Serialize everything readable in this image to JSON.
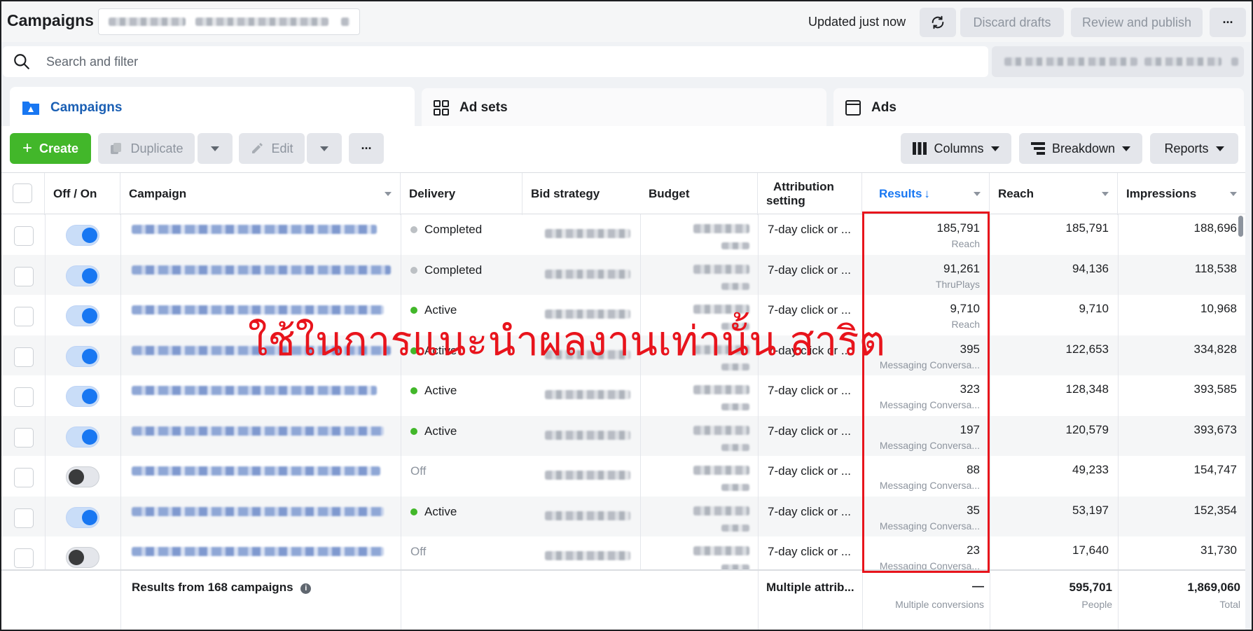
{
  "app": {
    "title": "Campaigns",
    "updated": "Updated just now",
    "discard_label": "Discard drafts",
    "review_label": "Review and publish",
    "more_label": "···"
  },
  "search": {
    "placeholder": "Search and filter"
  },
  "tabs": [
    {
      "label": "Campaigns",
      "icon": "folder-icon",
      "active": true
    },
    {
      "label": "Ad sets",
      "icon": "grid-icon",
      "active": false
    },
    {
      "label": "Ads",
      "icon": "ad-frame-icon",
      "active": false
    }
  ],
  "toolbar": {
    "create_label": "Create",
    "duplicate_label": "Duplicate",
    "edit_label": "Edit",
    "columns_label": "Columns",
    "breakdown_label": "Breakdown",
    "reports_label": "Reports"
  },
  "columns": {
    "offon": "Off / On",
    "campaign": "Campaign",
    "delivery": "Delivery",
    "bid_strategy": "Bid strategy",
    "budget": "Budget",
    "attribution_line1": "Attribution",
    "attribution_line2": "setting",
    "results": "Results",
    "reach": "Reach",
    "impressions": "Impressions"
  },
  "rows": [
    {
      "on": true,
      "delivery": "Completed",
      "status": "completed",
      "attribution": "7-day click or ...",
      "results": "185,791",
      "result_type": "Reach",
      "reach": "185,791",
      "impressions": "188,696"
    },
    {
      "on": true,
      "delivery": "Completed",
      "status": "completed",
      "attribution": "7-day click or ...",
      "results": "91,261",
      "result_type": "ThruPlays",
      "reach": "94,136",
      "impressions": "118,538"
    },
    {
      "on": true,
      "delivery": "Active",
      "status": "active",
      "attribution": "7-day click or ...",
      "results": "9,710",
      "result_type": "Reach",
      "reach": "9,710",
      "impressions": "10,968"
    },
    {
      "on": true,
      "delivery": "Active",
      "status": "active",
      "attribution": "7-day click or ...",
      "results": "395",
      "result_type": "Messaging Conversa...",
      "reach": "122,653",
      "impressions": "334,828"
    },
    {
      "on": true,
      "delivery": "Active",
      "status": "active",
      "attribution": "7-day click or ...",
      "results": "323",
      "result_type": "Messaging Conversa...",
      "reach": "128,348",
      "impressions": "393,585"
    },
    {
      "on": true,
      "delivery": "Active",
      "status": "active",
      "attribution": "7-day click or ...",
      "results": "197",
      "result_type": "Messaging Conversa...",
      "reach": "120,579",
      "impressions": "393,673"
    },
    {
      "on": false,
      "delivery": "Off",
      "status": "off",
      "attribution": "7-day click or ...",
      "results": "88",
      "result_type": "Messaging Conversa...",
      "reach": "49,233",
      "impressions": "154,747"
    },
    {
      "on": true,
      "delivery": "Active",
      "status": "active",
      "attribution": "7-day click or ...",
      "results": "35",
      "result_type": "Messaging Conversa...",
      "reach": "53,197",
      "impressions": "152,354"
    },
    {
      "on": false,
      "delivery": "Off",
      "status": "off",
      "attribution": "7-day click or ...",
      "results": "23",
      "result_type": "Messaging Conversa...",
      "reach": "17,640",
      "impressions": "31,730"
    }
  ],
  "footer": {
    "summary": "Results from 168 campaigns",
    "attribution": "Multiple attrib...",
    "results": "—",
    "results_sub": "Multiple conversions",
    "reach": "595,701",
    "reach_sub": "People",
    "impressions": "1,869,060",
    "impressions_sub": "Total"
  },
  "overlay": {
    "watermark_text": "ใช้ในการแนะนำผลงานเท่านั้น สาริต"
  },
  "colors": {
    "accent": "#1877f2",
    "create": "#42b72a",
    "active_dot": "#42b72a",
    "completed_dot": "#bcc0c4",
    "highlight": "#e8141c"
  }
}
